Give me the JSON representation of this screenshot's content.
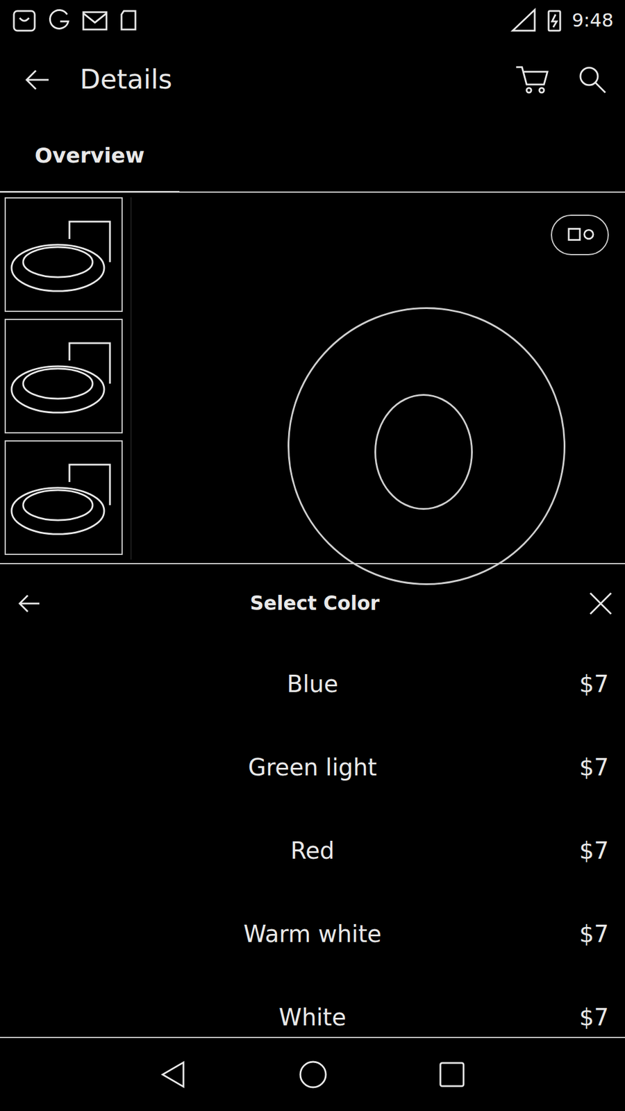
{
  "status_bar": {
    "time": "9:48"
  },
  "toolbar": {
    "title": "Details"
  },
  "tabs": [
    {
      "label": "Overview",
      "selected": true
    }
  ],
  "sheet": {
    "title": "Select Color",
    "options": [
      {
        "name": "Blue",
        "price": "$7"
      },
      {
        "name": "Green light",
        "price": "$7"
      },
      {
        "name": "Red",
        "price": "$7"
      },
      {
        "name": "Warm white",
        "price": "$7"
      },
      {
        "name": "White",
        "price": "$7"
      }
    ]
  }
}
